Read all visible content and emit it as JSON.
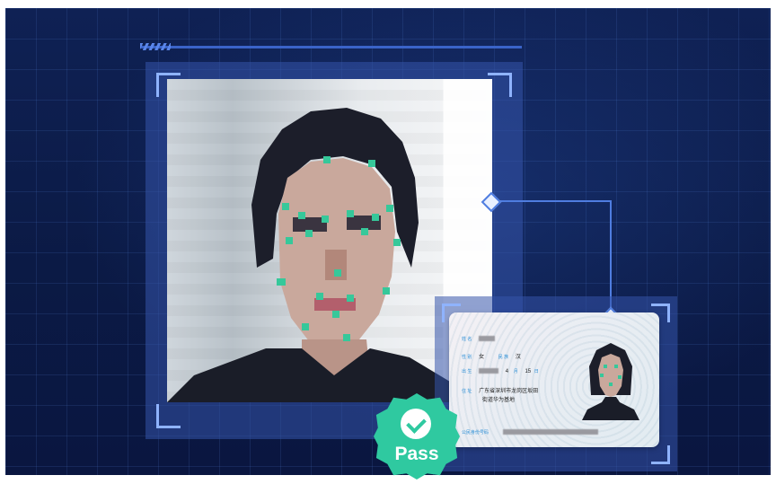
{
  "badge": {
    "label": "Pass",
    "color": "#2fc9a0"
  },
  "id_card": {
    "name_label": "姓 名",
    "gender_label": "性 别",
    "gender_value": "女",
    "ethnicity_label": "民 族",
    "ethnicity_value": "汉",
    "birth_label": "出 生",
    "birth_month": "4",
    "month_unit": "月",
    "birth_day": "15",
    "day_unit": "日",
    "address_label": "住 址",
    "address_line1": "广东省深圳市龙岗区坂田",
    "address_line2": "街道华为基地",
    "id_number_label": "公民身份号码"
  },
  "colors": {
    "accent": "#4f7de0",
    "bracket": "#8fb3ff",
    "landmark": "#36c89a"
  }
}
